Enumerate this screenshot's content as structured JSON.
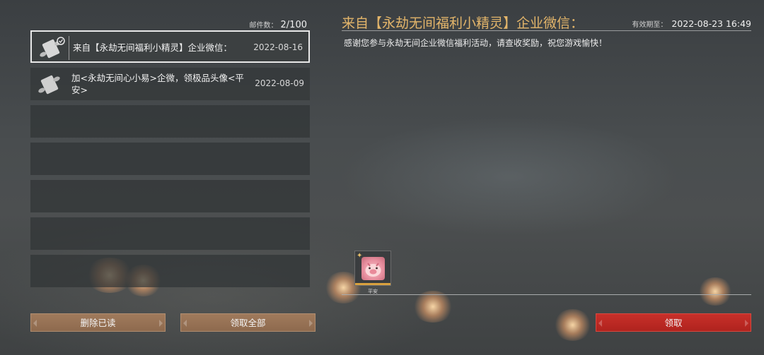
{
  "mailbox": {
    "count_label": "邮件数：",
    "count_value": "2/100",
    "mails": [
      {
        "subject": "来自【永劫无间福利小精灵】企业微信：",
        "date": "2022-08-16",
        "selected": true
      },
      {
        "subject": "加<永劫无间心小易>企微，领极品头像<平安>",
        "date": "2022-08-09",
        "selected": false
      }
    ],
    "empty_slots": 5
  },
  "detail": {
    "title": "来自【永劫无间福利小精灵】企业微信：",
    "expiry_label": "有效期至：",
    "expiry_value": "2022-08-23 16:49",
    "body": "感谢您参与永劫无间企业微信福利活动，请查收奖励，祝您游戏愉快！",
    "reward": {
      "label": "平安",
      "icon": "avatar-frame-icon"
    }
  },
  "buttons": {
    "delete_read": "删除已读",
    "claim_all": "领取全部",
    "claim": "领取"
  },
  "colors": {
    "title_gold": "#e3b56a",
    "button_brown": "#97714f",
    "button_red": "#c0292a"
  }
}
